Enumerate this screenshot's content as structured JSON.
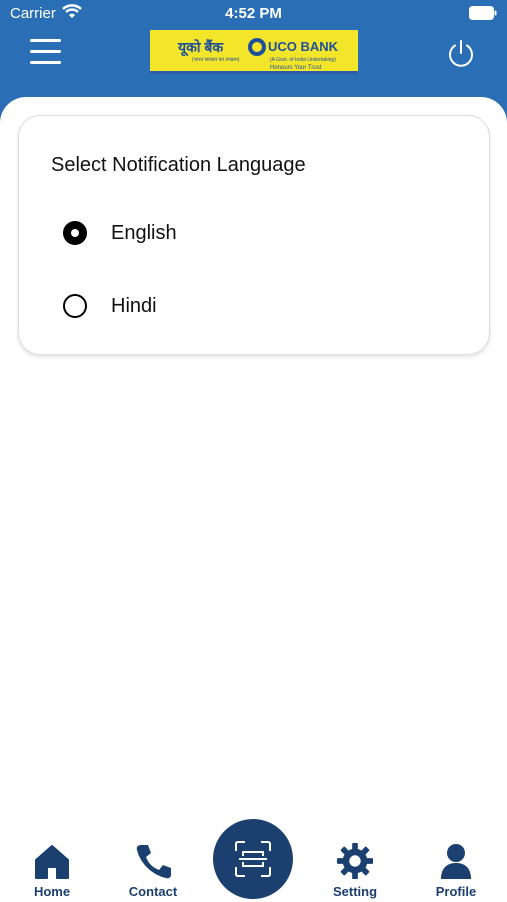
{
  "status_bar": {
    "carrier": "Carrier",
    "time": "4:52 PM"
  },
  "header": {
    "logo": {
      "hindi_text": "यूको बैंक",
      "english_text": "UCO BANK",
      "hindi_sub": "(भारत सरकार का उपक्रम)",
      "english_sub": "(A Govt. of India Undertaking)",
      "tagline": "Honours Your Trust",
      "brand_color": "#f3e52a"
    },
    "menu_icon": "hamburger-icon",
    "power_icon": "power-icon",
    "background_color": "#2a6fb5"
  },
  "card": {
    "title": "Select Notification Language",
    "options": [
      {
        "label": "English",
        "selected": true
      },
      {
        "label": "Hindi",
        "selected": false
      }
    ]
  },
  "bottom_nav": {
    "items": [
      {
        "label": "Home",
        "icon": "home-icon"
      },
      {
        "label": "Contact",
        "icon": "phone-icon"
      },
      {
        "label": "Setting",
        "icon": "gear-icon"
      },
      {
        "label": "Profile",
        "icon": "person-icon"
      }
    ],
    "center_button_icon": "scan-icon",
    "accent_color": "#1b3f6e"
  }
}
